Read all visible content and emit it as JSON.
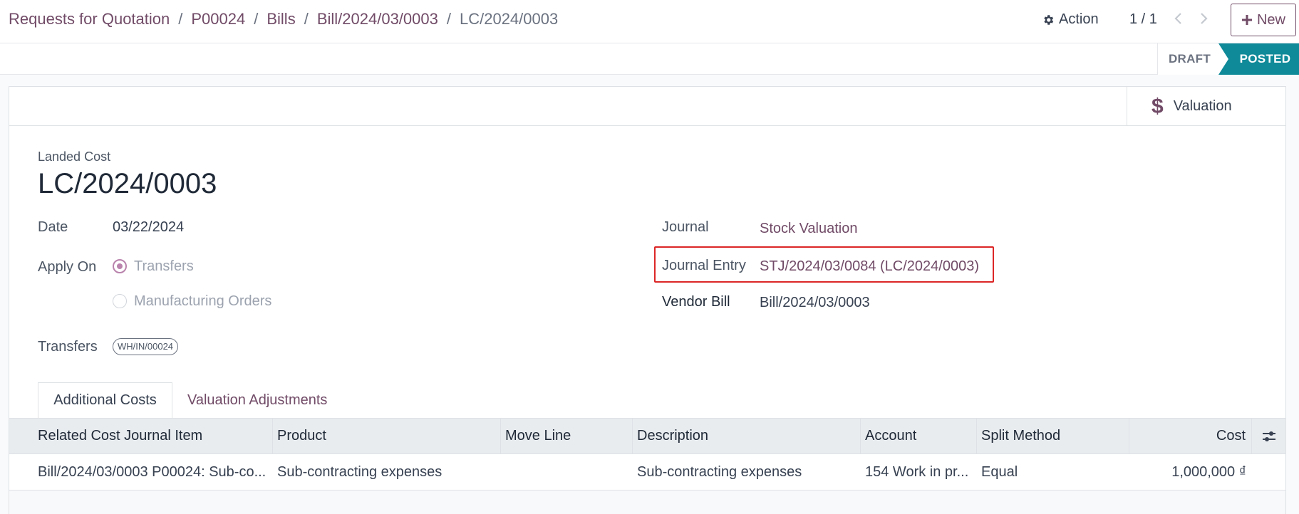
{
  "breadcrumb": {
    "items": [
      "Requests for Quotation",
      "P00024",
      "Bills",
      "Bill/2024/03/0003"
    ],
    "current": "LC/2024/0003"
  },
  "toolbar": {
    "action_label": "Action",
    "pager": "1 / 1",
    "new_label": "New"
  },
  "status": {
    "stages": [
      "DRAFT",
      "POSTED"
    ],
    "active": "POSTED"
  },
  "smart_buttons": {
    "valuation_label": "Valuation"
  },
  "form": {
    "type_label": "Landed Cost",
    "name": "LC/2024/0003",
    "date_label": "Date",
    "date_value": "03/22/2024",
    "apply_on_label": "Apply On",
    "apply_on_options": [
      "Transfers",
      "Manufacturing Orders"
    ],
    "apply_on_selected": "Transfers",
    "transfers_label": "Transfers",
    "transfers_tags": [
      "WH/IN/00024"
    ],
    "journal_label": "Journal",
    "journal_value": "Stock Valuation",
    "journal_entry_label": "Journal Entry",
    "journal_entry_value": "STJ/2024/03/0084 (LC/2024/0003)",
    "vendor_bill_label": "Vendor Bill",
    "vendor_bill_value": "Bill/2024/03/0003"
  },
  "tabs": [
    {
      "label": "Additional Costs",
      "active": true
    },
    {
      "label": "Valuation Adjustments",
      "active": false
    }
  ],
  "table": {
    "columns": [
      "Related Cost Journal Item",
      "Product",
      "Move Line",
      "Description",
      "Account",
      "Split Method",
      "Cost"
    ],
    "rows": [
      [
        "Bill/2024/03/0003 P00024: Sub-co...",
        "Sub-contracting expenses",
        "",
        "Sub-contracting expenses",
        "154 Work in pr...",
        "Equal",
        "1,000,000 ₫"
      ]
    ]
  },
  "colors": {
    "brand": "#714b67",
    "posted": "#0f8a99",
    "highlight": "#dc2626"
  }
}
